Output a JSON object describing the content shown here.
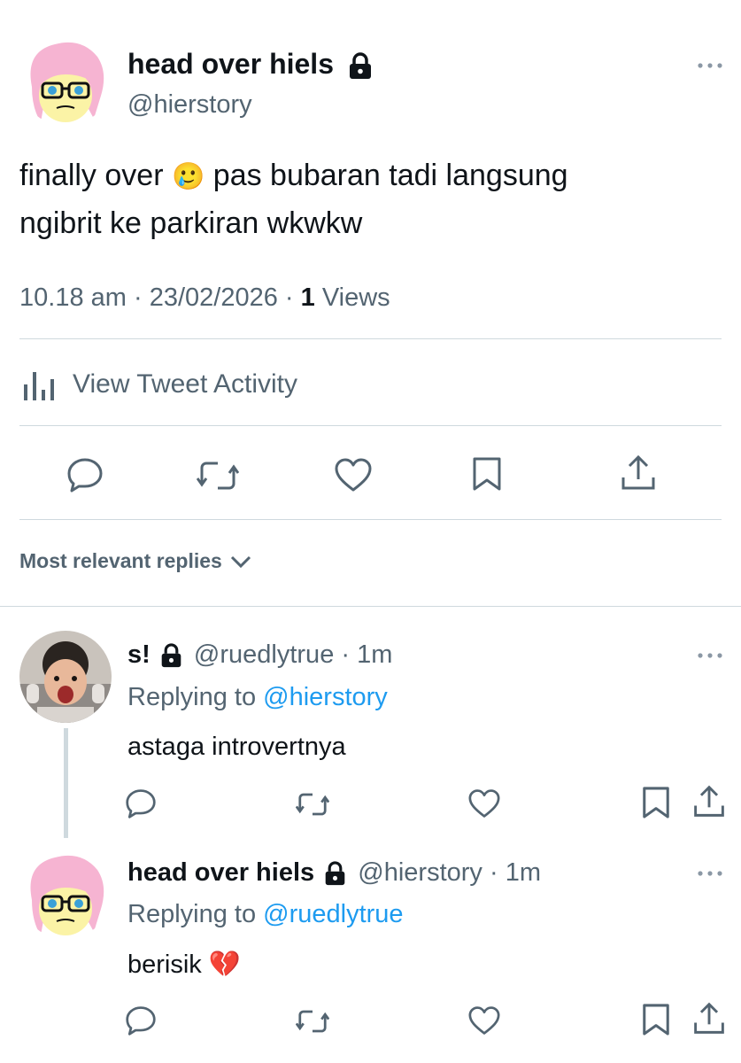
{
  "main_tweet": {
    "display_name": "head over hiels",
    "handle": "@hierstory",
    "text_part1": "finally over",
    "emoji": "🥲",
    "text_part2": "pas bubaran tadi langsung",
    "text_line2": "ngibrit ke parkiran wkwkw",
    "time": "10.18 am",
    "date": "23/02/2026",
    "views_count": "1",
    "views_label": "Views",
    "activity_label": "View Tweet Activity"
  },
  "replies_header": "Most relevant replies",
  "replies": [
    {
      "display_name": "s!",
      "handle": "@ruedlytrue",
      "age": "1m",
      "replying_prefix": "Replying to",
      "replying_to": "@hierstory",
      "text": "astaga introvertnya"
    },
    {
      "display_name": "head over hiels",
      "handle": "@hierstory",
      "age": "1m",
      "replying_prefix": "Replying to",
      "replying_to": "@ruedlytrue",
      "text": "berisik",
      "emoji": "💔"
    }
  ],
  "colors": {
    "text": "#0f1419",
    "secondary": "#536471",
    "accent": "#1d9bf0",
    "divider": "#cfd9de"
  },
  "icons": [
    "lock-icon",
    "more-icon",
    "activity-chart-icon",
    "reply-icon",
    "retweet-icon",
    "like-icon",
    "bookmark-icon",
    "share-icon",
    "chevron-down-icon"
  ]
}
